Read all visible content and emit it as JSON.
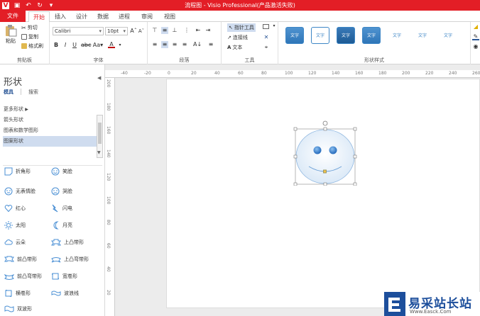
{
  "window": {
    "title": "流程图 - Visio Professional(产品激活失败)",
    "app_icon": "V"
  },
  "tabs": [
    {
      "label": "文件"
    },
    {
      "label": "开始"
    },
    {
      "label": "插入"
    },
    {
      "label": "设计"
    },
    {
      "label": "数据"
    },
    {
      "label": "进程"
    },
    {
      "label": "审阅"
    },
    {
      "label": "视图"
    }
  ],
  "ribbon": {
    "clipboard": {
      "paste": "粘贴",
      "cut": "剪切",
      "copy": "复制",
      "format_painter": "格式刷",
      "label": "剪贴板"
    },
    "font": {
      "name": "Calibri",
      "size": "10pt",
      "label": "字体"
    },
    "paragraph": {
      "label": "段落"
    },
    "tools": {
      "pointer": "指针工具",
      "connector": "连接线",
      "text": "文本",
      "label": "工具"
    },
    "shape_styles": {
      "swatch_text": "文字",
      "label": "形状样式"
    }
  },
  "sidebar": {
    "title": "形状",
    "tabs": [
      "模具",
      "搜索"
    ],
    "more_shapes": "更多形状",
    "stencils": [
      "箭头形状",
      "图表和数学图形",
      "图案形状"
    ],
    "shapes": [
      "折角形",
      "笑脸",
      "无表情脸",
      "哭脸",
      "红心",
      "闪电",
      "太阳",
      "月亮",
      "云朵",
      "上凸带形",
      "前凸带形",
      "上凸弯带形",
      "前凸弯带形",
      "宽卷形",
      "横卷形",
      "波浪线",
      "双波形"
    ]
  },
  "rulers": {
    "h": [
      "-40",
      "-20",
      "0",
      "20",
      "40",
      "60",
      "80",
      "100",
      "120",
      "140",
      "160",
      "180",
      "200",
      "220",
      "240",
      "260"
    ],
    "v": [
      "200",
      "180",
      "160",
      "140",
      "120",
      "100",
      "80",
      "60",
      "40",
      "20"
    ]
  },
  "watermark": {
    "brand": "易采站长站",
    "url": "Www.Easck.Com"
  },
  "colors": {
    "accent": "#e31e26",
    "shape_blue": "#4a8fd4",
    "selection": "#cfdcef"
  }
}
